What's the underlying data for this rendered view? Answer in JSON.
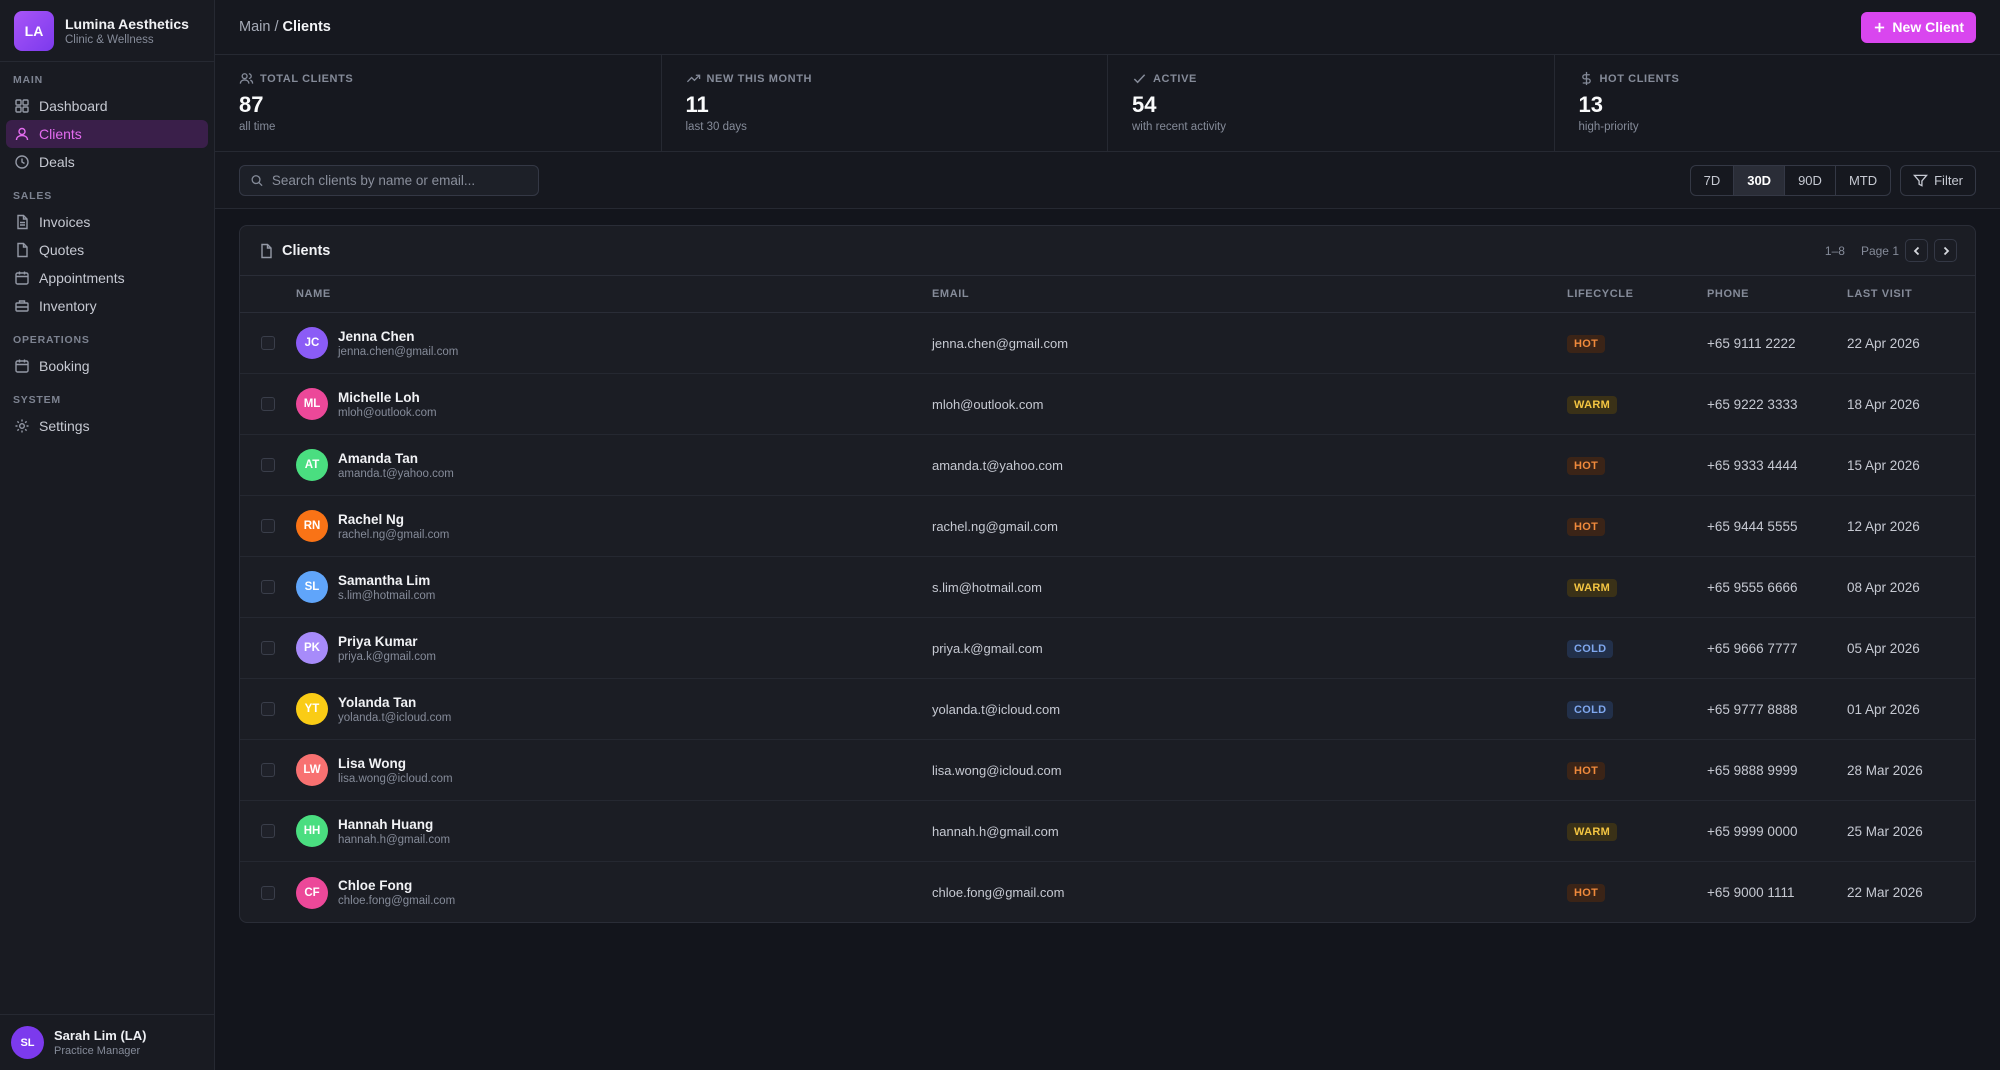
{
  "brand": {
    "initials": "LA",
    "name": "Lumina Aesthetics",
    "subtitle": "Clinic & Wellness"
  },
  "nav": {
    "main": {
      "title": "MAIN",
      "items": [
        {
          "label": "Dashboard",
          "icon": "dashboard-icon"
        },
        {
          "label": "Clients",
          "icon": "user-icon",
          "active": true
        },
        {
          "label": "Deals",
          "icon": "clock-icon"
        }
      ]
    },
    "sales": {
      "title": "SALES",
      "items": [
        {
          "label": "Invoices",
          "icon": "document-icon"
        },
        {
          "label": "Quotes",
          "icon": "file-icon"
        },
        {
          "label": "Appointments",
          "icon": "calendar-icon"
        },
        {
          "label": "Inventory",
          "icon": "box-icon"
        }
      ]
    },
    "operations": {
      "title": "OPERATIONS",
      "items": [
        {
          "label": "Booking",
          "icon": "calendar-icon"
        }
      ]
    },
    "system": {
      "title": "SYSTEM",
      "items": [
        {
          "label": "Settings",
          "icon": "gear-icon"
        }
      ]
    }
  },
  "user": {
    "initials": "SL",
    "name": "Sarah Lim (LA)",
    "role": "Practice Manager"
  },
  "breadcrumb": {
    "parent": "Main",
    "separator": "/",
    "current": "Clients"
  },
  "new_client_label": "New Client",
  "stats": [
    {
      "label": "TOTAL CLIENTS",
      "value": "87",
      "sub": "all time",
      "icon": "users-icon"
    },
    {
      "label": "NEW THIS MONTH",
      "value": "11",
      "sub": "last 30 days",
      "icon": "trend-up-icon"
    },
    {
      "label": "ACTIVE",
      "value": "54",
      "sub": "with recent activity",
      "icon": "check-icon"
    },
    {
      "label": "HOT CLIENTS",
      "value": "13",
      "sub": "high-priority",
      "icon": "dollar-icon"
    }
  ],
  "search": {
    "placeholder": "Search clients by name or email..."
  },
  "ranges": [
    "7D",
    "30D",
    "90D",
    "MTD"
  ],
  "active_range": "30D",
  "filter_label": "Filter",
  "table": {
    "title": "Clients",
    "range_text": "1–8",
    "page_text": "Page 1",
    "columns": {
      "name": "NAME",
      "email": "EMAIL",
      "lifecycle": "LIFECYCLE",
      "phone": "PHONE",
      "last_visit": "LAST VISIT"
    },
    "rows": [
      {
        "initials": "JC",
        "color": "#8b5cf6",
        "name": "Jenna Chen",
        "sub_email": "jenna.chen@gmail.com",
        "email": "jenna.chen@gmail.com",
        "lifecycle": "HOT",
        "phone": "+65 9111 2222",
        "last_visit": "22 Apr 2026"
      },
      {
        "initials": "ML",
        "color": "#ec4899",
        "name": "Michelle Loh",
        "sub_email": "mloh@outlook.com",
        "email": "mloh@outlook.com",
        "lifecycle": "WARM",
        "phone": "+65 9222 3333",
        "last_visit": "18 Apr 2026"
      },
      {
        "initials": "AT",
        "color": "#4ade80",
        "name": "Amanda Tan",
        "sub_email": "amanda.t@yahoo.com",
        "email": "amanda.t@yahoo.com",
        "lifecycle": "HOT",
        "phone": "+65 9333 4444",
        "last_visit": "15 Apr 2026"
      },
      {
        "initials": "RN",
        "color": "#f97316",
        "name": "Rachel Ng",
        "sub_email": "rachel.ng@gmail.com",
        "email": "rachel.ng@gmail.com",
        "lifecycle": "HOT",
        "phone": "+65 9444 5555",
        "last_visit": "12 Apr 2026"
      },
      {
        "initials": "SL",
        "color": "#60a5fa",
        "name": "Samantha Lim",
        "sub_email": "s.lim@hotmail.com",
        "email": "s.lim@hotmail.com",
        "lifecycle": "WARM",
        "phone": "+65 9555 6666",
        "last_visit": "08 Apr 2026"
      },
      {
        "initials": "PK",
        "color": "#a78bfa",
        "name": "Priya Kumar",
        "sub_email": "priya.k@gmail.com",
        "email": "priya.k@gmail.com",
        "lifecycle": "COLD",
        "phone": "+65 9666 7777",
        "last_visit": "05 Apr 2026"
      },
      {
        "initials": "YT",
        "color": "#facc15",
        "name": "Yolanda Tan",
        "sub_email": "yolanda.t@icloud.com",
        "email": "yolanda.t@icloud.com",
        "lifecycle": "COLD",
        "phone": "+65 9777 8888",
        "last_visit": "01 Apr 2026"
      },
      {
        "initials": "LW",
        "color": "#f87171",
        "name": "Lisa Wong",
        "sub_email": "lisa.wong@icloud.com",
        "email": "lisa.wong@icloud.com",
        "lifecycle": "HOT",
        "phone": "+65 9888 9999",
        "last_visit": "28 Mar 2026"
      },
      {
        "initials": "HH",
        "color": "#4ade80",
        "name": "Hannah Huang",
        "sub_email": "hannah.h@gmail.com",
        "email": "hannah.h@gmail.com",
        "lifecycle": "WARM",
        "phone": "+65 9999 0000",
        "last_visit": "25 Mar 2026"
      },
      {
        "initials": "CF",
        "color": "#ec4899",
        "name": "Chloe Fong",
        "sub_email": "chloe.fong@gmail.com",
        "email": "chloe.fong@gmail.com",
        "lifecycle": "HOT",
        "phone": "+65 9000 1111",
        "last_visit": "22 Mar 2026"
      }
    ]
  }
}
